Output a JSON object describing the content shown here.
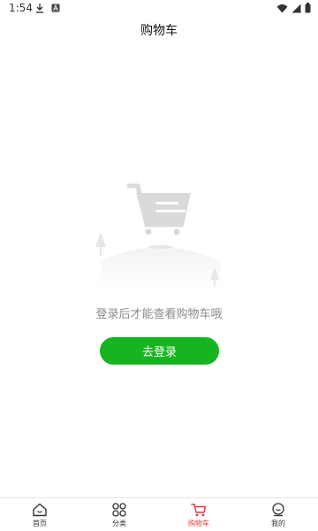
{
  "status_bar": {
    "time": "1:54",
    "icons": [
      "download-icon",
      "notification-a-icon",
      "wifi-icon",
      "signal-icon",
      "battery-icon"
    ]
  },
  "header": {
    "title": "购物车"
  },
  "empty_state": {
    "illustration": "empty-cart-illustration",
    "message": "登录后才能查看购物车哦",
    "login_button": "去登录"
  },
  "tabbar": {
    "active_color": "#e5393e",
    "items": [
      {
        "label": "首页",
        "icon": "home-icon"
      },
      {
        "label": "分类",
        "icon": "category-icon"
      },
      {
        "label": "购物车",
        "icon": "cart-icon"
      },
      {
        "label": "我的",
        "icon": "profile-icon"
      }
    ]
  },
  "colors": {
    "accent_green": "#16b51f",
    "message_gray": "#8a8a8a"
  }
}
